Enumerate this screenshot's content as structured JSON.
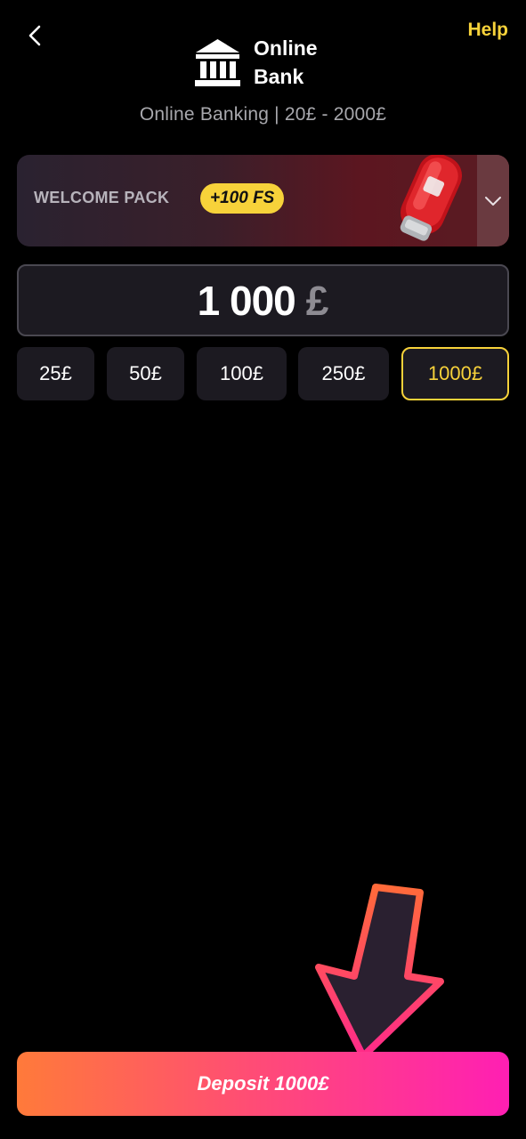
{
  "header": {
    "help_label": "Help",
    "brand_line1": "Online",
    "brand_line2": "Bank",
    "subtitle": "Online Banking | 20£ - 2000£",
    "back_icon": "chevron-left-icon",
    "logo_icon": "bank-icon"
  },
  "welcome": {
    "label": "WELCOME PACK",
    "badge": "+100 FS",
    "image": "car-key-image",
    "toggle_icon": "chevron-down-icon"
  },
  "amount": {
    "value": "1 000",
    "currency": "£"
  },
  "presets": [
    {
      "label": "25£",
      "selected": false
    },
    {
      "label": "50£",
      "selected": false
    },
    {
      "label": "100£",
      "selected": false
    },
    {
      "label": "250£",
      "selected": false
    },
    {
      "label": "1000£",
      "selected": true
    }
  ],
  "deposit": {
    "label": "Deposit 1000£"
  },
  "colors": {
    "accent_yellow": "#f7d23a",
    "background": "#000000",
    "field_bg": "#1c1a21",
    "gradient_start": "#ff7a3a",
    "gradient_end": "#ff1fb3"
  },
  "overlay": {
    "icon": "pointer-arrow-icon"
  }
}
